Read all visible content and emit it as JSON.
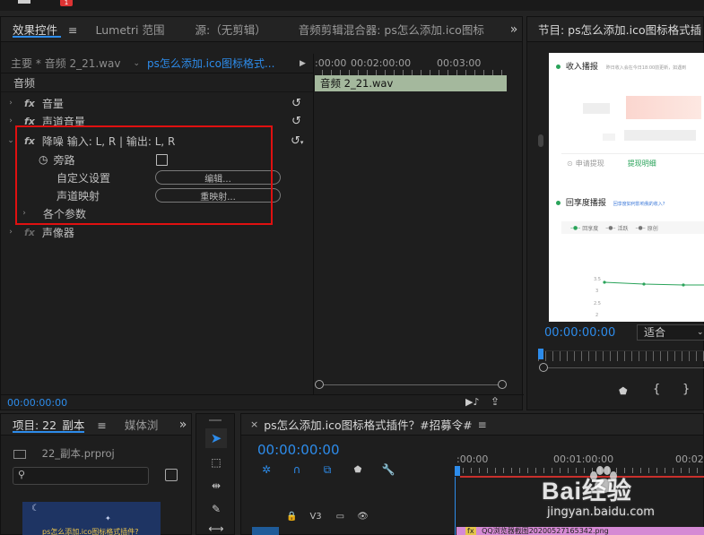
{
  "topbar": {
    "badge": "1"
  },
  "effect_controls": {
    "tabs": [
      {
        "label": "效果控件"
      },
      {
        "label": "Lumetri 范围"
      },
      {
        "label": "源:（无剪辑）"
      },
      {
        "label": "音频剪辑混合器: ps怎么添加.ico图标"
      }
    ],
    "overflow": "»",
    "clip_master": "主要 * 音频 2_21.wav",
    "clip_sequence": "ps怎么添加.ico图标格式...",
    "ruler": [
      ":00:00",
      "00:02:00:00",
      "00:03:00"
    ],
    "audio_clip_label": "音频 2_21.wav",
    "section_label": "音频",
    "effects": [
      {
        "name": "音量"
      },
      {
        "name": "声道音量"
      },
      {
        "name": "降噪 输入: L, R | 输出: L, R"
      },
      {
        "name": "声像器"
      }
    ],
    "bypass_label": "旁路",
    "custom_setup_label": "自定义设置",
    "edit_button": "编辑...",
    "channel_map_label": "声道映射",
    "remap_button": "重映射...",
    "params_label": "各个参数",
    "timecode": "00:00:00:00"
  },
  "program": {
    "title": "节目: ps怎么添加.ico图标格式插",
    "timecode": "00:00:00:00",
    "fit": "适合",
    "preview": {
      "income_title": "收入播报",
      "income_sub": "昨日收入会在今日18:00前更新，如遇到",
      "withdraw": "申请提现",
      "withdraw_detail": "提现明细",
      "return_title": "回享度播报",
      "return_link": "回享度如何影响我的收入?",
      "legend": [
        "回享度",
        "活跃",
        "原创"
      ],
      "yticks": [
        "3.5",
        "3",
        "2.5",
        "2"
      ]
    }
  },
  "project": {
    "tabs": [
      {
        "label": "项目: 22_副本"
      },
      {
        "label": "媒体浏"
      }
    ],
    "file": "22_副本.prproj",
    "thumb_caption": "ps怎么添加.ico图标格式插件?"
  },
  "timeline": {
    "title": "ps怎么添加.ico图标格式插件？#招募令#",
    "timecode": "00:00:00:00",
    "ruler": [
      ":00:00",
      "00:01:00:00",
      "00:02:"
    ],
    "track": "V3",
    "clip": "QQ浏览器截图20200527165342.png"
  },
  "watermark": {
    "brand": "Bai经验",
    "site": "jingyan.baidu.com"
  }
}
